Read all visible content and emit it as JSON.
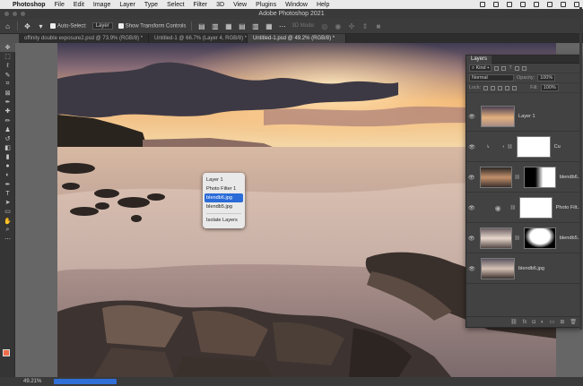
{
  "mac_menubar": {
    "apple": "",
    "items": [
      "Photoshop",
      "File",
      "Edit",
      "Image",
      "Layer",
      "Type",
      "Select",
      "Filter",
      "3D",
      "View",
      "Plugins",
      "Window",
      "Help"
    ]
  },
  "window_title": "Adobe Photoshop 2021",
  "options_bar": {
    "auto_select_label": "Auto-Select:",
    "auto_select_value": "Layer",
    "transform_label": "Show Transform Controls",
    "mode_label": "3D Mode:"
  },
  "tabs": [
    "offinity double exposure2.psd @ 73.9% (RGB/8) *",
    "Untitled-1 @ 66.7% (Layer 4, RGB/8) *",
    "Untitled-1.psd @ 49.2% (RGB/8) *"
  ],
  "context_menu": {
    "items": [
      "Layer 1",
      "Photo Filter 1",
      "blendb6.jpg",
      "blendb5.jpg",
      "Isolate Layers"
    ],
    "highlighted": "blendb6.jpg"
  },
  "layers_panel": {
    "tab": "Layers",
    "kind_label": "Kind",
    "blend_mode": "Normal",
    "opacity_label": "Opacity:",
    "opacity_value": "100%",
    "lock_label": "Lock:",
    "fill_label": "Fill:",
    "fill_value": "100%",
    "layers": [
      {
        "name": "Layer 1"
      },
      {
        "name": "Cu"
      },
      {
        "name": "blendb6..."
      },
      {
        "name": "Photo Filt..."
      },
      {
        "name": "blendb5..."
      },
      {
        "name": "blendb6.jpg"
      }
    ]
  },
  "status": {
    "zoom": "49.21%"
  },
  "colors": {
    "accent": "#2a6bd8",
    "foreground_swatch": "#ef6c4a"
  }
}
